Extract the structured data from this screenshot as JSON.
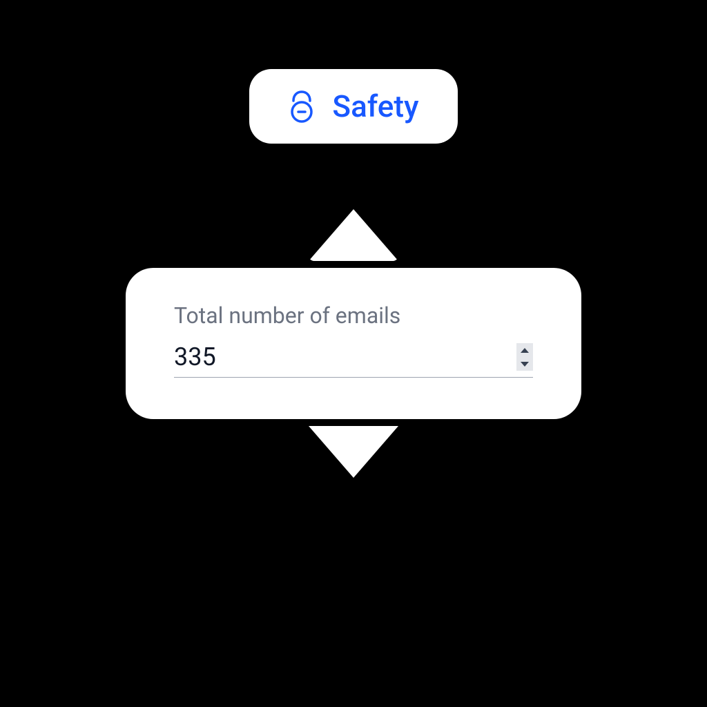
{
  "header": {
    "safety_label": "Safety",
    "accent_color": "#1858FF"
  },
  "form": {
    "field_label": "Total number of emails",
    "field_value": "335"
  }
}
